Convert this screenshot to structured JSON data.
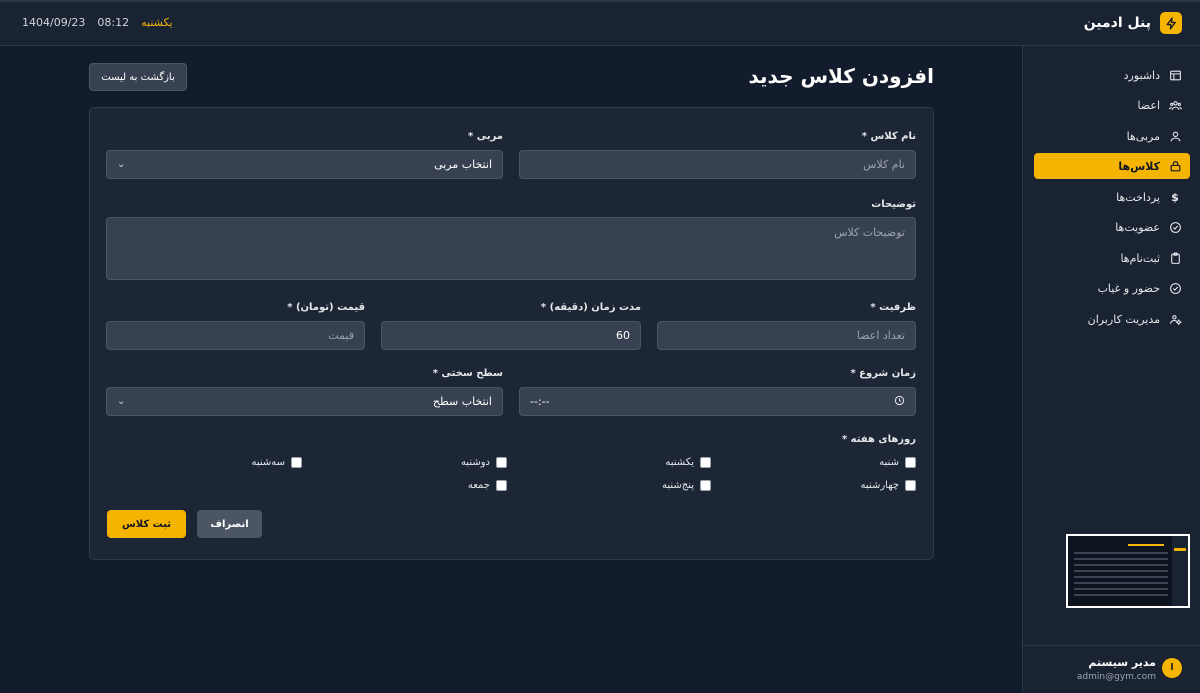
{
  "header": {
    "brand": "پنل ادمین",
    "day": "یکشنبه",
    "time": "08:12",
    "date": "1404/09/23"
  },
  "sidebar": {
    "items": [
      {
        "label": "داشبورد",
        "icon": "dashboard-icon"
      },
      {
        "label": "اعضا",
        "icon": "members-icon"
      },
      {
        "label": "مربی‌ها",
        "icon": "user-icon"
      },
      {
        "label": "کلاس‌ها",
        "icon": "class-icon",
        "active": true
      },
      {
        "label": "پرداخت‌ها",
        "icon": "dollar-icon"
      },
      {
        "label": "عضویت‌ها",
        "icon": "check-circle-icon"
      },
      {
        "label": "ثبت‌نام‌ها",
        "icon": "clipboard-icon"
      },
      {
        "label": "حضور و غیاب",
        "icon": "check-circle-icon"
      },
      {
        "label": "مدیریت کاربران",
        "icon": "user-gear-icon"
      }
    ],
    "user": {
      "initial": "ا",
      "name": "مدیر سیستم",
      "email": "admin@gym.com"
    }
  },
  "main": {
    "title": "افزودن کلاس جدید",
    "back_label": "بازگشت به لیست",
    "form": {
      "class_name": {
        "label": "نام کلاس *",
        "placeholder": "نام کلاس"
      },
      "trainer": {
        "label": "مربی *",
        "value": "انتخاب مربی"
      },
      "description": {
        "label": "توضیحات",
        "placeholder": "توضیحات کلاس"
      },
      "capacity": {
        "label": "ظرفیت *",
        "placeholder": "تعداد اعضا"
      },
      "duration": {
        "label": "مدت زمان (دقیقه) *",
        "value": "60"
      },
      "price": {
        "label": "قیمت (تومان) *",
        "placeholder": "قیمت"
      },
      "start_time": {
        "label": "زمان شروع *",
        "value": "--:--"
      },
      "difficulty": {
        "label": "سطح سختی *",
        "value": "انتخاب سطح"
      },
      "weekdays": {
        "label": "روزهای هفته *",
        "days": [
          "شنبه",
          "یکشنبه",
          "دوشنبه",
          "سه‌شنبه",
          "چهارشنبه",
          "پنج‌شنبه",
          "جمعه"
        ]
      },
      "submit_label": "ثبت کلاس",
      "cancel_label": "انصراف"
    }
  },
  "colors": {
    "accent": "#f4b400",
    "background": "#131c2c",
    "panel": "#1a2332",
    "card": "#1c2635",
    "input": "#374151"
  }
}
